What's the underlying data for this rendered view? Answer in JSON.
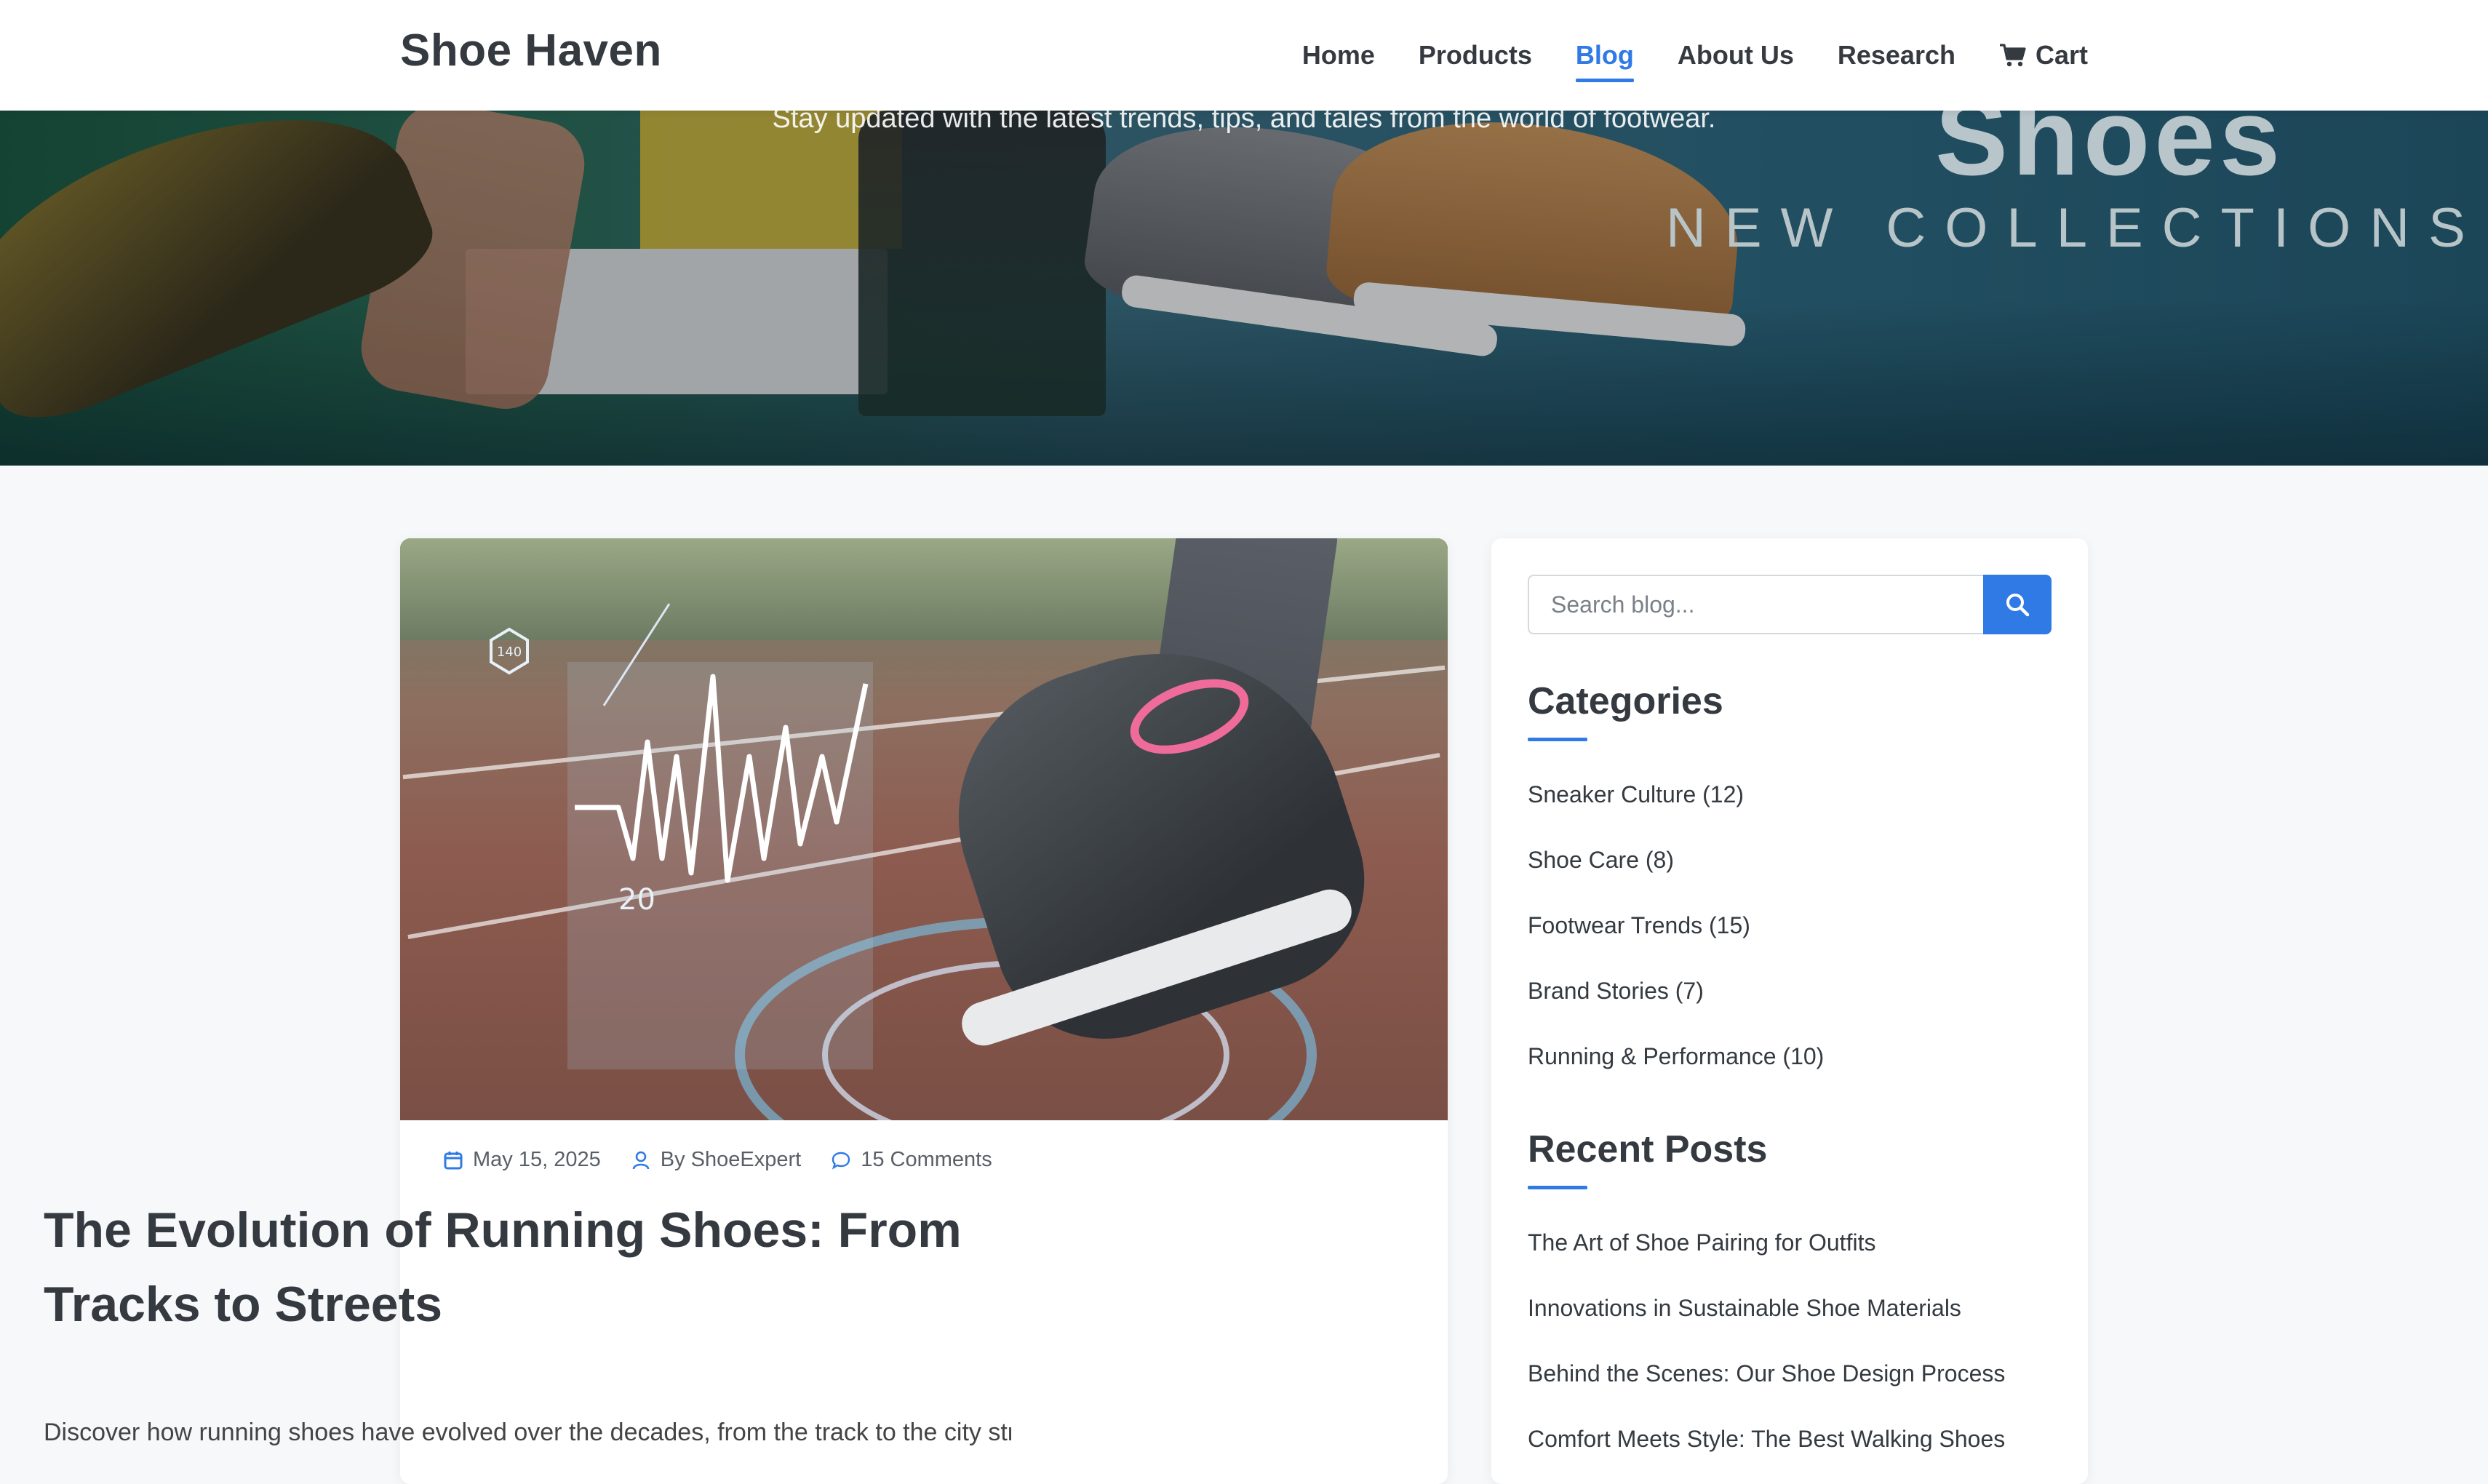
{
  "header": {
    "brand": "Shoe Haven",
    "nav": [
      {
        "label": "Home",
        "active": false
      },
      {
        "label": "Products",
        "active": false
      },
      {
        "label": "Blog",
        "active": true
      },
      {
        "label": "About Us",
        "active": false
      },
      {
        "label": "Research",
        "active": false
      },
      {
        "label": "Cart",
        "active": false,
        "icon": "cart-icon"
      }
    ]
  },
  "hero": {
    "subtitle": "Stay updated with the latest trends, tips, and tales from the world of footwear.",
    "brand_word": "Shoes",
    "brand_sub": "NEW COLLECTIONS"
  },
  "post": {
    "date": "May 15, 2025",
    "author": "By ShoeExpert",
    "comments": "15 Comments",
    "title": "The Evolution of Running Shoes: From Tracks to Streets",
    "excerpt": "Discover how running shoes have evolved over the decades, from the track to the city streets.",
    "hud_labels": [
      "140",
      "20"
    ]
  },
  "sidebar": {
    "search_placeholder": "Search blog...",
    "categories_title": "Categories",
    "categories": [
      "Sneaker Culture (12)",
      "Shoe Care (8)",
      "Footwear Trends (15)",
      "Brand Stories (7)",
      "Running & Performance (10)"
    ],
    "recent_title": "Recent Posts",
    "recent_posts": [
      "The Art of Shoe Pairing for Outfits",
      "Innovations in Sustainable Shoe Materials",
      "Behind the Scenes: Our Shoe Design Process",
      "Comfort Meets Style: The Best Walking Shoes"
    ]
  },
  "colors": {
    "accent": "#2f7ae5",
    "heading": "#343a40",
    "page_bg": "#f6f8fa"
  }
}
